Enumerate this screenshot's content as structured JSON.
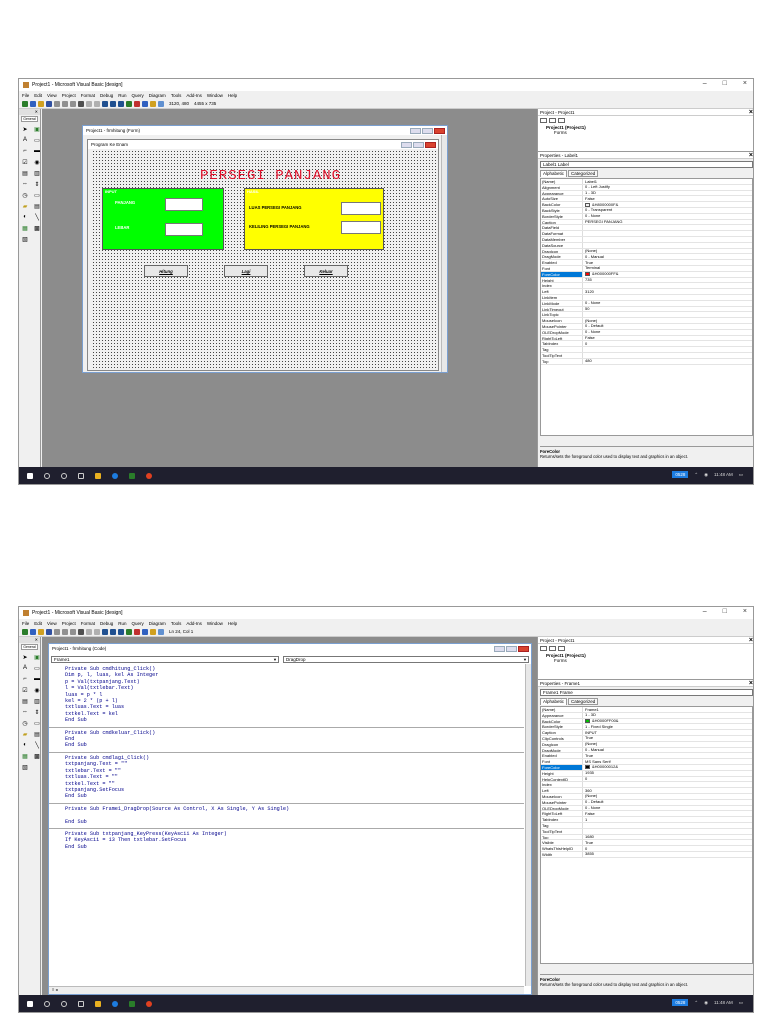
{
  "screenshot1": {
    "title": "Project1 - Microsoft Visual Basic [design]",
    "menu": [
      "File",
      "Edit",
      "View",
      "Project",
      "Format",
      "Debug",
      "Run",
      "Query",
      "Diagram",
      "Tools",
      "Add-Ins",
      "Window",
      "Help"
    ],
    "position": "3120, 480",
    "size": "4455 x 735",
    "toolbox": {
      "tab": "General"
    },
    "formwin_title": "Project1 - frmhitung (Form)",
    "inner_form_title": "Program Ke Enam",
    "heading": "PERSEGI PANJANG",
    "frame_input": {
      "caption": "INPUT",
      "panjang": "PANJANG",
      "lebar": "LEBAR",
      "color": "#00ff00"
    },
    "frame_hasil": {
      "caption": "HASIL",
      "luas": "LUAS PERSEGI PANJANG",
      "keliling": "KELILING PERSEGI PANJANG",
      "color": "#ffff00"
    },
    "buttons": {
      "hitung": "Hitung",
      "lagi": "Lagi",
      "keluar": "Keluar"
    },
    "project_panel": {
      "title": "Project - Project1",
      "root": "Project1 (Project1)",
      "forms": "Forms"
    },
    "properties": {
      "title": "Properties - Label1",
      "object": "Label1  Label",
      "tabs": [
        "Alphabetic",
        "Categorized"
      ],
      "rows": [
        {
          "n": "(Name)",
          "v": "Label1"
        },
        {
          "n": "Alignment",
          "v": "0 - Left Justify"
        },
        {
          "n": "Appearance",
          "v": "1 - 3D"
        },
        {
          "n": "AutoSize",
          "v": "False"
        },
        {
          "n": "BackColor",
          "v": "&H8000000F&",
          "c": "#f0f0f0"
        },
        {
          "n": "BackStyle",
          "v": "0 - Transparent"
        },
        {
          "n": "BorderStyle",
          "v": "0 - None"
        },
        {
          "n": "Caption",
          "v": "PERSEGI PANJANG"
        },
        {
          "n": "DataField",
          "v": ""
        },
        {
          "n": "DataFormat",
          "v": ""
        },
        {
          "n": "DataMember",
          "v": ""
        },
        {
          "n": "DataSource",
          "v": ""
        },
        {
          "n": "DragIcon",
          "v": "(None)"
        },
        {
          "n": "DragMode",
          "v": "0 - Manual"
        },
        {
          "n": "Enabled",
          "v": "True"
        },
        {
          "n": "Font",
          "v": "Terminal"
        },
        {
          "n": "ForeColor",
          "v": "&H000000FF&",
          "c": "#ff0000",
          "sel": true
        },
        {
          "n": "Height",
          "v": "735"
        },
        {
          "n": "Index",
          "v": ""
        },
        {
          "n": "Left",
          "v": "3120"
        },
        {
          "n": "LinkItem",
          "v": ""
        },
        {
          "n": "LinkMode",
          "v": "0 - None"
        },
        {
          "n": "LinkTimeout",
          "v": "50"
        },
        {
          "n": "LinkTopic",
          "v": ""
        },
        {
          "n": "MouseIcon",
          "v": "(None)"
        },
        {
          "n": "MousePointer",
          "v": "0 - Default"
        },
        {
          "n": "OLEDropMode",
          "v": "0 - None"
        },
        {
          "n": "RightToLeft",
          "v": "False"
        },
        {
          "n": "TabIndex",
          "v": "0"
        },
        {
          "n": "Tag",
          "v": ""
        },
        {
          "n": "ToolTipText",
          "v": ""
        },
        {
          "n": "Top",
          "v": "480"
        }
      ],
      "desc_title": "ForeColor",
      "desc": "Returns/sets the foreground color used to display text and graphics in an object."
    },
    "taskbar": {
      "num": "0528",
      "time": "11:48 AM"
    }
  },
  "screenshot2": {
    "title": "Project1 - Microsoft Visual Basic [design]",
    "menu": [
      "File",
      "Edit",
      "View",
      "Project",
      "Format",
      "Debug",
      "Run",
      "Query",
      "Diagram",
      "Tools",
      "Add-Ins",
      "Window",
      "Help"
    ],
    "cursor": "Ln 24, Col 1",
    "codewin_title": "Project1 - frmhitung (Code)",
    "object_combo": "Frame1",
    "proc_combo": "DragDrop",
    "code": [
      [
        "Private Sub cmdhitung_Click()",
        "Dim p, l, luas, kel As Integer",
        "p = Val(txtpanjang.Text)",
        "l = Val(txtlebar.Text)",
        "luas = p * l",
        "kel = 2 * (p + l)",
        "txtluas.Text = luas",
        "txtkel.Text = kel",
        "End Sub"
      ],
      [
        "Private Sub cmdkeluar_Click()",
        "End",
        "End Sub"
      ],
      [
        "Private Sub cmdlagi_Click()",
        "txtpanjang.Text = \"\"",
        "txtlebar.Text = \"\"",
        "txtluas.Text = \"\"",
        "txtkel.Text = \"\"",
        "txtpanjang.SetFocus",
        "End Sub"
      ],
      [
        "Private Sub Frame1_DragDrop(Source As Control, X As Single, Y As Single)",
        "",
        "End Sub"
      ],
      [
        "Private Sub txtpanjang_KeyPress(KeyAscii As Integer)",
        "If KeyAscii = 13 Then txtlebar.SetFocus",
        "End Sub"
      ]
    ],
    "properties": {
      "title": "Properties - Frame1",
      "object": "Frame1  Frame",
      "tabs": [
        "Alphabetic",
        "Categorized"
      ],
      "rows": [
        {
          "n": "(Name)",
          "v": "Frame1"
        },
        {
          "n": "Appearance",
          "v": "1 - 3D"
        },
        {
          "n": "BackColor",
          "v": "&H0000FF00&",
          "c": "#00c000"
        },
        {
          "n": "BorderStyle",
          "v": "1 - Fixed Single"
        },
        {
          "n": "Caption",
          "v": "INPUT"
        },
        {
          "n": "ClipControls",
          "v": "True"
        },
        {
          "n": "DragIcon",
          "v": "(None)"
        },
        {
          "n": "DragMode",
          "v": "0 - Manual"
        },
        {
          "n": "Enabled",
          "v": "True"
        },
        {
          "n": "Font",
          "v": "MS Sans Serif"
        },
        {
          "n": "ForeColor",
          "v": "&H00000012&",
          "c": "#000000",
          "sel": true
        },
        {
          "n": "Height",
          "v": "1935"
        },
        {
          "n": "HelpContextID",
          "v": "0"
        },
        {
          "n": "Index",
          "v": ""
        },
        {
          "n": "Left",
          "v": "360"
        },
        {
          "n": "MouseIcon",
          "v": "(None)"
        },
        {
          "n": "MousePointer",
          "v": "0 - Default"
        },
        {
          "n": "OLEDropMode",
          "v": "0 - None"
        },
        {
          "n": "RightToLeft",
          "v": "False"
        },
        {
          "n": "TabIndex",
          "v": "1"
        },
        {
          "n": "Tag",
          "v": ""
        },
        {
          "n": "ToolTipText",
          "v": ""
        },
        {
          "n": "Top",
          "v": "1680"
        },
        {
          "n": "Visible",
          "v": "True"
        },
        {
          "n": "WhatsThisHelpID",
          "v": "0"
        },
        {
          "n": "Width",
          "v": "3855"
        }
      ],
      "desc_title": "ForeColor",
      "desc": "Returns/sets the foreground color used to display text and graphics in an object."
    },
    "taskbar": {
      "num": "0528",
      "time": "11:48 AM"
    }
  },
  "colors": {
    "tb": [
      "#2a7d2a",
      "#3060c0",
      "#d0a020",
      "#c03030",
      "#6090d0",
      "#808080"
    ]
  }
}
